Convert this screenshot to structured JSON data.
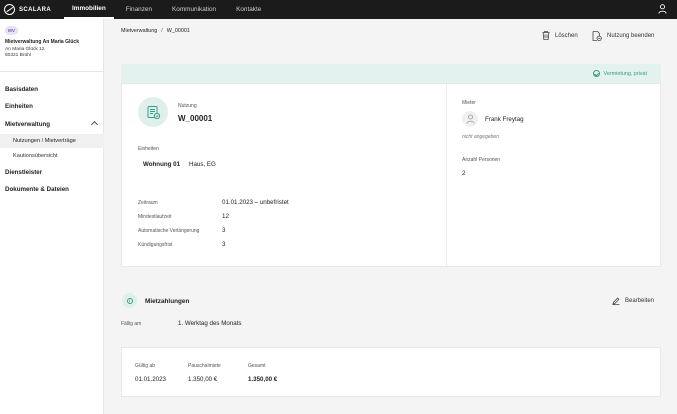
{
  "app": {
    "logo_text": "SCALARA"
  },
  "topnav": {
    "items": [
      {
        "label": "Immobilien",
        "active": true
      },
      {
        "label": "Finanzen"
      },
      {
        "label": "Kommunikation"
      },
      {
        "label": "Kontakte"
      }
    ]
  },
  "sidebar": {
    "avatar_initials": "MV",
    "org_name": "Mietverwaltung An Maria Glück",
    "org_street": "An Maria Glück 12",
    "org_city": "50321 Brühl",
    "items": {
      "basisdaten": "Basisdaten",
      "einheiten": "Einheiten",
      "mietverwaltung": "Mietverwaltung",
      "nutzungen": "Nutzungen / Mietverträge",
      "kautionsuebersicht": "Kautionsübersicht",
      "dienstleister": "Dienstleister",
      "dokumente": "Dokumente & Dateien"
    }
  },
  "breadcrumb": {
    "parent": "Mietverwaltung",
    "separator": "/",
    "current": "W_00001"
  },
  "actions": {
    "delete": "Löschen",
    "end_usage": "Nutzung beenden"
  },
  "status": {
    "label": "Vermietung, privat",
    "color": "#3b9c86"
  },
  "usage": {
    "label": "Nutzung",
    "id": "W_00001",
    "units_label": "Einheiten",
    "unit_name": "Wohnung 01",
    "unit_location": "Haus, EG",
    "details": [
      {
        "label": "Zeitraum",
        "value": "01.01.2023 – unbefristet"
      },
      {
        "label": "Mindestlaufzeit",
        "value": "12"
      },
      {
        "label": "Automatische Verlängerung",
        "value": "3"
      },
      {
        "label": "Kündigungsfrist",
        "value": "3"
      }
    ]
  },
  "tenant": {
    "label": "Mieter",
    "name": "Frank Freytag",
    "note": "nicht angegeben",
    "persons_label": "Anzahl Personen",
    "persons_value": "2"
  },
  "payments": {
    "title": "Mietzahlungen",
    "edit": "Bearbeiten",
    "due_label": "Fällig am",
    "due_value": "1. Werktag des Monats",
    "columns": {
      "valid_from": "Gültig ab",
      "flat_rent": "Pauschalmiete",
      "total": "Gesamt"
    },
    "row": {
      "valid_from": "01.01.2023",
      "flat_rent": "1.350,00 €",
      "total": "1.350,00 €"
    }
  }
}
